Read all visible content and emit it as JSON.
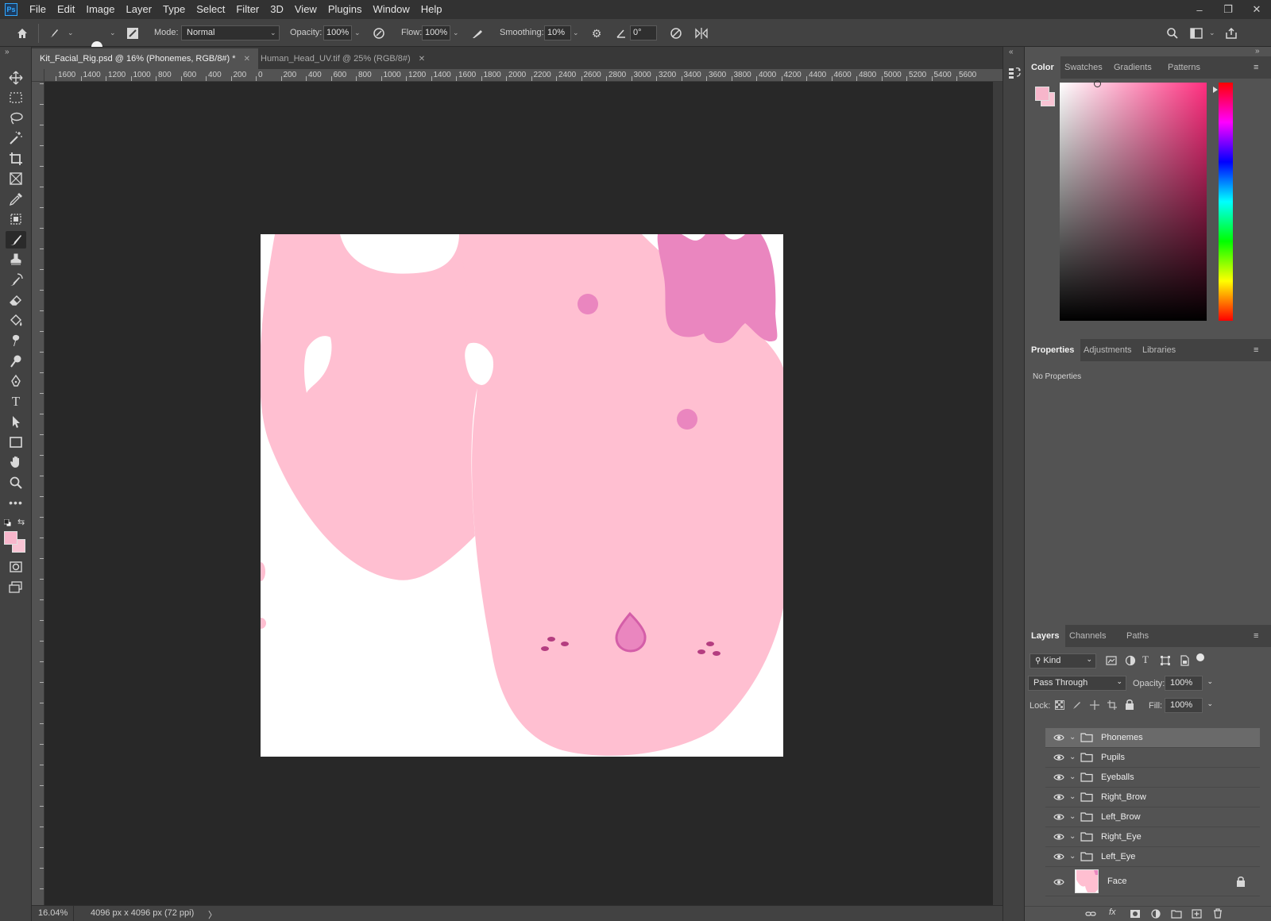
{
  "app": {
    "logo": "Ps"
  },
  "menu": [
    "File",
    "Edit",
    "Image",
    "Layer",
    "Type",
    "Select",
    "Filter",
    "3D",
    "View",
    "Plugins",
    "Window",
    "Help"
  ],
  "window_controls": {
    "minimize": "–",
    "restore": "❐",
    "close": "✕"
  },
  "options": {
    "brush_size": "155",
    "mode_label": "Mode:",
    "mode_value": "Normal",
    "opacity_label": "Opacity:",
    "opacity_value": "100%",
    "flow_label": "Flow:",
    "flow_value": "100%",
    "smoothing_label": "Smoothing:",
    "smoothing_value": "10%",
    "angle_value": "0°"
  },
  "tabs": [
    {
      "label": "Kit_Facial_Rig.psd @ 16% (Phonemes, RGB/8#) *",
      "close": "✕"
    },
    {
      "label": "Human_Head_UV.tif @ 25% (RGB/8#)",
      "close": "✕"
    }
  ],
  "ruler_top": [
    "1600",
    "1400",
    "1200",
    "1000",
    "800",
    "600",
    "400",
    "200",
    "0",
    "200",
    "400",
    "600",
    "800",
    "1000",
    "1200",
    "1400",
    "1600",
    "1800",
    "2000",
    "2200",
    "2400",
    "2600",
    "2800",
    "3000",
    "3200",
    "3400",
    "3600",
    "3800",
    "4000",
    "4200",
    "4400",
    "4600",
    "4800",
    "5000",
    "5200",
    "5400",
    "5600"
  ],
  "status": {
    "zoom": "16.04%",
    "doc_size": "4096 px x 4096 px (72 ppi)",
    "arrow": "〉"
  },
  "colors": {
    "foreground": "#f7b6cb",
    "background": "#f9c4d4",
    "face_pink": "#ffbfd1",
    "accent_pink": "#ea86bf",
    "dot_pink": "#ea86bf",
    "freckle": "#b43d80"
  },
  "color_panel": {
    "tabs": [
      "Color",
      "Swatches",
      "Gradients",
      "Patterns"
    ]
  },
  "properties_panel": {
    "tabs": [
      "Properties",
      "Adjustments",
      "Libraries"
    ],
    "empty_text": "No Properties"
  },
  "layers_panel": {
    "tabs": [
      "Layers",
      "Channels",
      "Paths"
    ],
    "filter_kind": "Kind",
    "blend_mode": "Pass Through",
    "opacity_label": "Opacity:",
    "opacity_value": "100%",
    "lock_label": "Lock:",
    "fill_label": "Fill:",
    "fill_value": "100%",
    "layers": [
      {
        "name": "Phonemes",
        "type": "group",
        "selected": true
      },
      {
        "name": "Pupils",
        "type": "group"
      },
      {
        "name": "Eyeballs",
        "type": "group"
      },
      {
        "name": "Right_Brow",
        "type": "group"
      },
      {
        "name": "Left_Brow",
        "type": "group"
      },
      {
        "name": "Right_Eye",
        "type": "group"
      },
      {
        "name": "Left_Eye",
        "type": "group"
      },
      {
        "name": "Face",
        "type": "pixel",
        "locked": true
      }
    ],
    "footer_icons": [
      "link-icon",
      "fx-icon",
      "mask-icon",
      "adjustment-icon",
      "group-icon",
      "new-layer-icon",
      "trash-icon"
    ]
  }
}
